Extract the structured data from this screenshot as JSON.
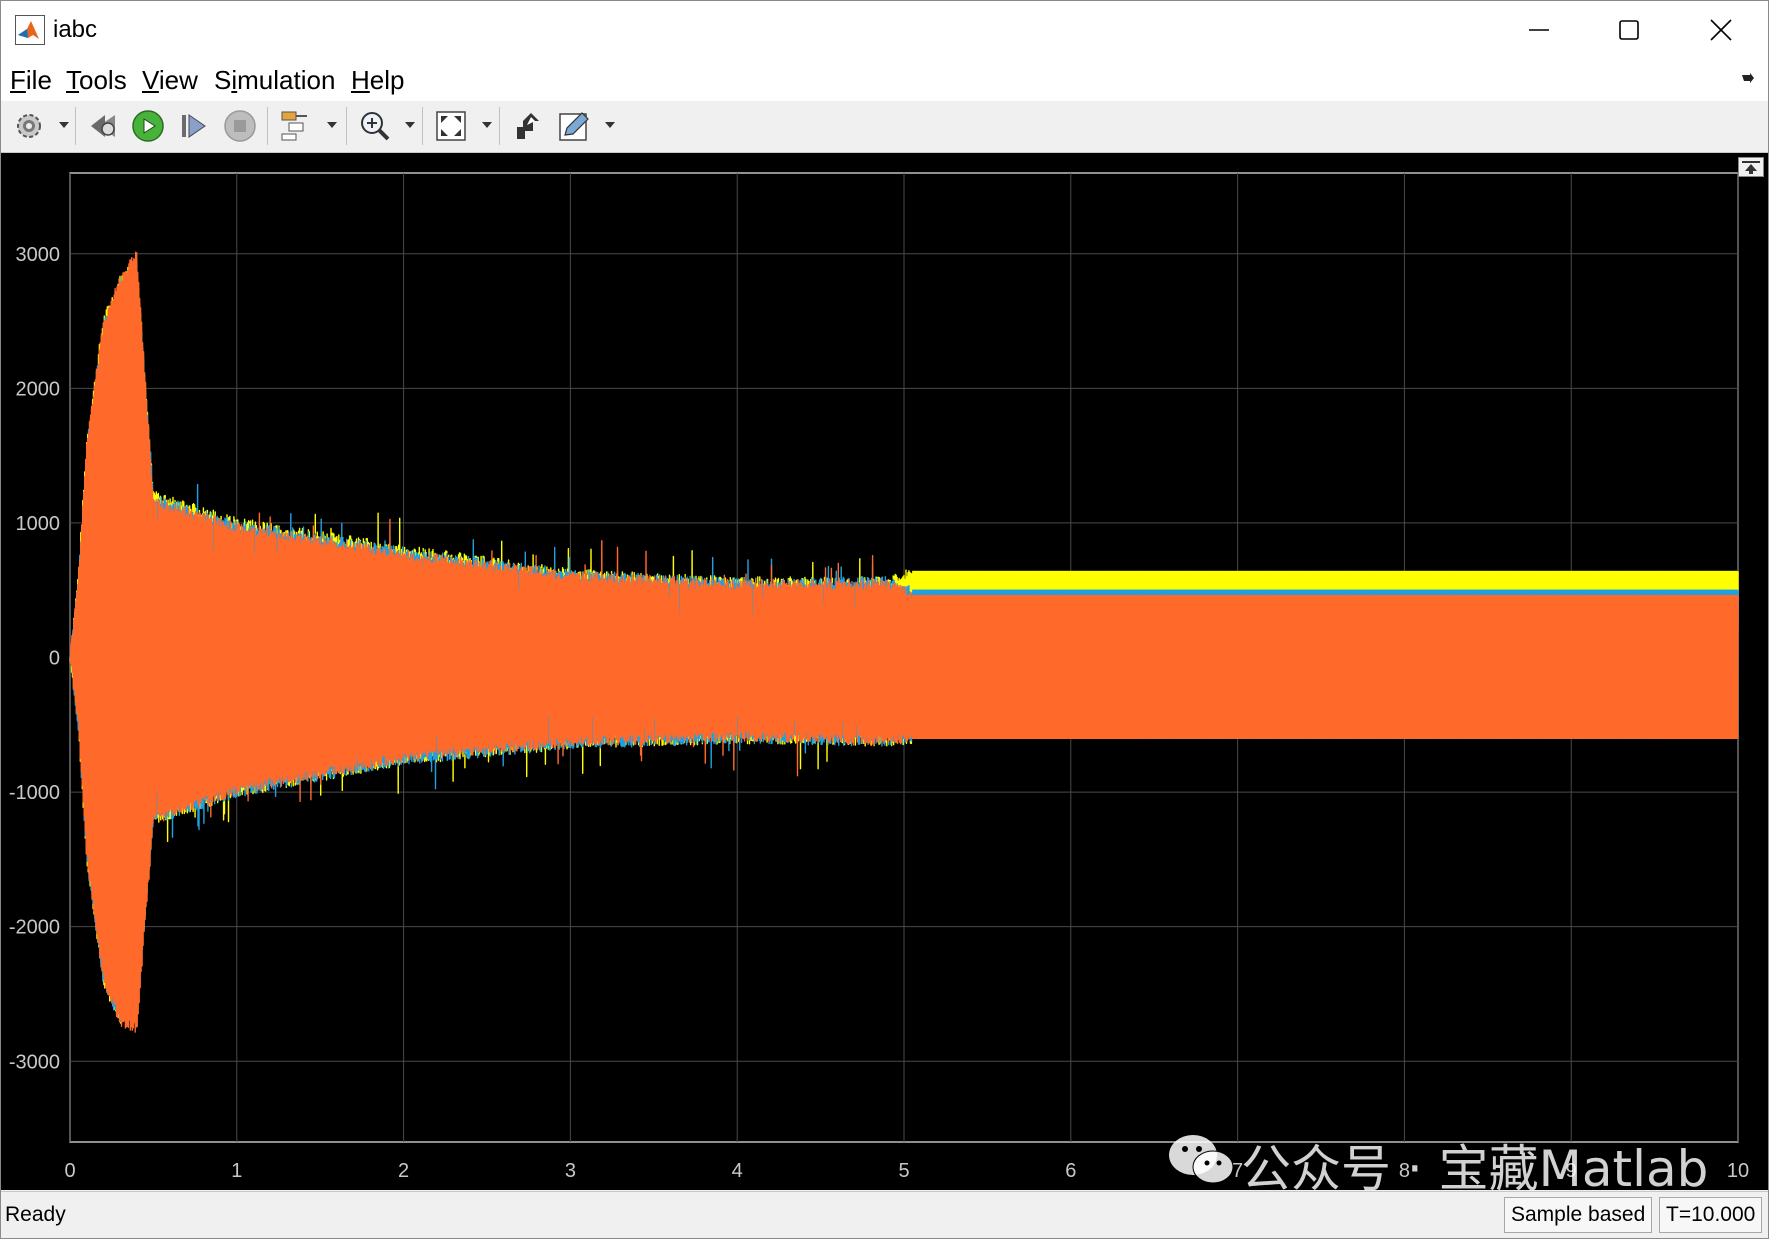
{
  "window": {
    "title": "iabc"
  },
  "menu": {
    "items": [
      {
        "label": "File",
        "key": "F",
        "rest": "ile"
      },
      {
        "label": "Tools",
        "key": "T",
        "rest": "ools"
      },
      {
        "label": "View",
        "key": "V",
        "rest": "iew"
      },
      {
        "label": "Simulation",
        "pre": "S",
        "key": "i",
        "rest": "mulation"
      },
      {
        "label": "Help",
        "key": "H",
        "rest": "elp"
      }
    ]
  },
  "toolbar": {
    "buttons": [
      "settings-icon",
      "step-back-icon",
      "run-icon",
      "step-forward-icon",
      "stop-icon",
      "signal-selector-icon",
      "zoom-in-icon",
      "fit-to-view-icon",
      "highlight-block-icon",
      "edit-icon"
    ]
  },
  "status": {
    "ready": "Ready",
    "mode": "Sample based",
    "time": "T=10.000"
  },
  "watermark": {
    "text": "公众号 · 宝藏Matlab"
  },
  "chart_data": {
    "type": "line",
    "title": "",
    "xlabel": "",
    "ylabel": "",
    "xlim": [
      0,
      10
    ],
    "ylim": [
      -3600,
      3600
    ],
    "xticks": [
      "0",
      "1",
      "2",
      "3",
      "4",
      "5",
      "6",
      "7",
      "8",
      "9",
      "10"
    ],
    "yticks": [
      "3000",
      "2000",
      "1000",
      "0",
      "-1000",
      "-2000",
      "-3000"
    ],
    "ytick_values": [
      3000,
      2000,
      1000,
      0,
      -1000,
      -2000,
      -3000
    ],
    "grid": true,
    "background": "#000000",
    "series": [
      {
        "color": "#ffff00",
        "envelope_t": [
          0,
          0.05,
          0.1,
          0.2,
          0.3,
          0.4,
          0.5,
          1,
          2,
          3,
          4,
          4.9,
          5.05,
          10
        ],
        "upper": [
          0,
          600,
          1600,
          2500,
          2800,
          2950,
          1200,
          1000,
          800,
          620,
          560,
          560,
          640,
          640
        ],
        "lower": [
          0,
          -500,
          -1500,
          -2400,
          -2700,
          -2600,
          -1200,
          -1000,
          -760,
          -640,
          -600,
          -620,
          -600,
          -600
        ]
      },
      {
        "color": "#1fa0e0",
        "envelope_t": [
          0,
          0.05,
          0.1,
          0.2,
          0.3,
          0.4,
          0.5,
          1,
          2,
          3,
          4,
          4.9,
          5.05,
          10
        ],
        "upper": [
          0,
          550,
          1550,
          2450,
          2780,
          2930,
          1180,
          980,
          780,
          610,
          550,
          560,
          500,
          500
        ],
        "lower": [
          0,
          -500,
          -1500,
          -2400,
          -2700,
          -2600,
          -1200,
          -1000,
          -760,
          -640,
          -600,
          -620,
          -600,
          -600
        ]
      },
      {
        "color": "#ff6a2a",
        "envelope_t": [
          0,
          0.05,
          0.1,
          0.2,
          0.3,
          0.4,
          0.5,
          1,
          2,
          3,
          4,
          4.9,
          5.05,
          10
        ],
        "upper": [
          0,
          580,
          1580,
          2480,
          2800,
          3000,
          1150,
          960,
          760,
          600,
          540,
          540,
          460,
          460
        ],
        "lower": [
          0,
          -480,
          -1480,
          -2380,
          -2700,
          -2760,
          -1200,
          -980,
          -740,
          -620,
          -580,
          -610,
          -600,
          -600
        ]
      }
    ]
  }
}
